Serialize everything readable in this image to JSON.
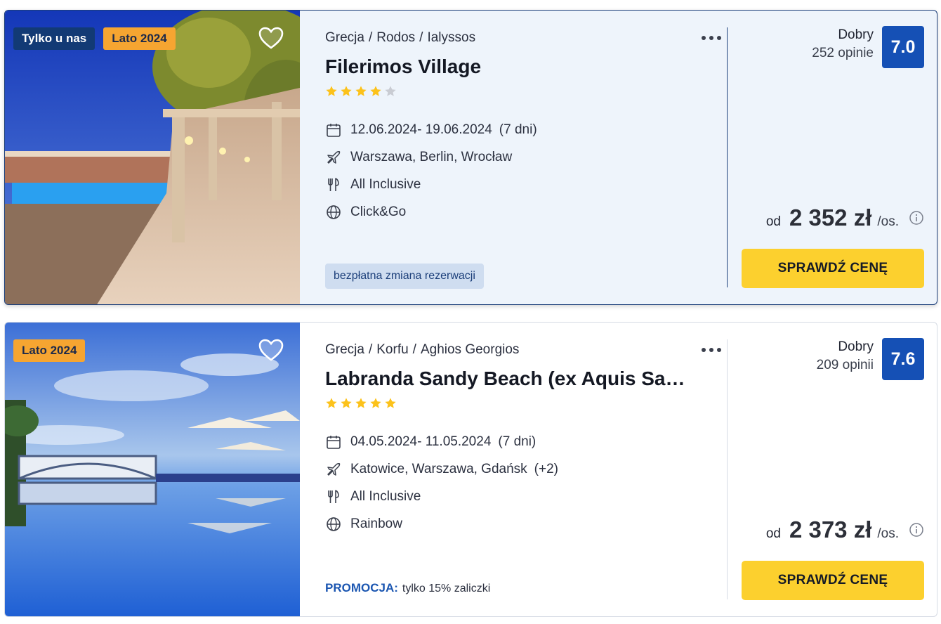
{
  "offers": [
    {
      "badges": [
        "Tylko u nas",
        "Lato 2024"
      ],
      "breadcrumb": [
        "Grecja",
        "Rodos",
        "Ialyssos"
      ],
      "name": "Filerimos Village",
      "stars": 4,
      "stars_max": 5,
      "dates": "12.06.2024- 19.06.2024",
      "duration": "(7 dni)",
      "departures": "Warszawa, Berlin, Wrocław",
      "departures_extra": "",
      "board": "All Inclusive",
      "operator": "Click&Go",
      "tag": "bezpłatna zmiana rezerwacji",
      "rating_label": "Dobry",
      "rating_count": "252 opinie",
      "score": "7.0",
      "price_prefix": "od",
      "price": "2 352 zł",
      "price_suffix": "/os.",
      "cta": "SPRAWDŹ CENĘ"
    },
    {
      "badges": [
        "Lato 2024"
      ],
      "breadcrumb": [
        "Grecja",
        "Korfu",
        "Aghios Georgios"
      ],
      "name": "Labranda Sandy Beach (ex Aquis Sandy Beach)",
      "stars": 5,
      "stars_max": 5,
      "dates": "04.05.2024- 11.05.2024",
      "duration": "(7 dni)",
      "departures": "Katowice, Warszawa, Gdańsk",
      "departures_extra": "(+2)",
      "board": "All Inclusive",
      "operator": "Rainbow",
      "promo_label": "PROMOCJA:",
      "promo_text": "tylko 15% zaliczki",
      "rating_label": "Dobry",
      "rating_count": "209 opinii",
      "score": "7.6",
      "price_prefix": "od",
      "price": "2 373 zł",
      "price_suffix": "/os.",
      "cta": "SPRAWDŹ CENĘ"
    }
  ],
  "icons": {
    "calendar": "calendar-icon",
    "plane": "plane-icon",
    "meal": "cutlery-icon",
    "operator": "globe-icon",
    "favorite": "heart-icon",
    "more": "more-dots-icon",
    "info": "info-icon"
  },
  "colors": {
    "badge_navy": "#123a75",
    "badge_orange": "#f6a531",
    "score_bg": "#1550b5",
    "cta_bg": "#fcd02e",
    "star": "#fcc21b",
    "promo": "#1b56b1"
  }
}
